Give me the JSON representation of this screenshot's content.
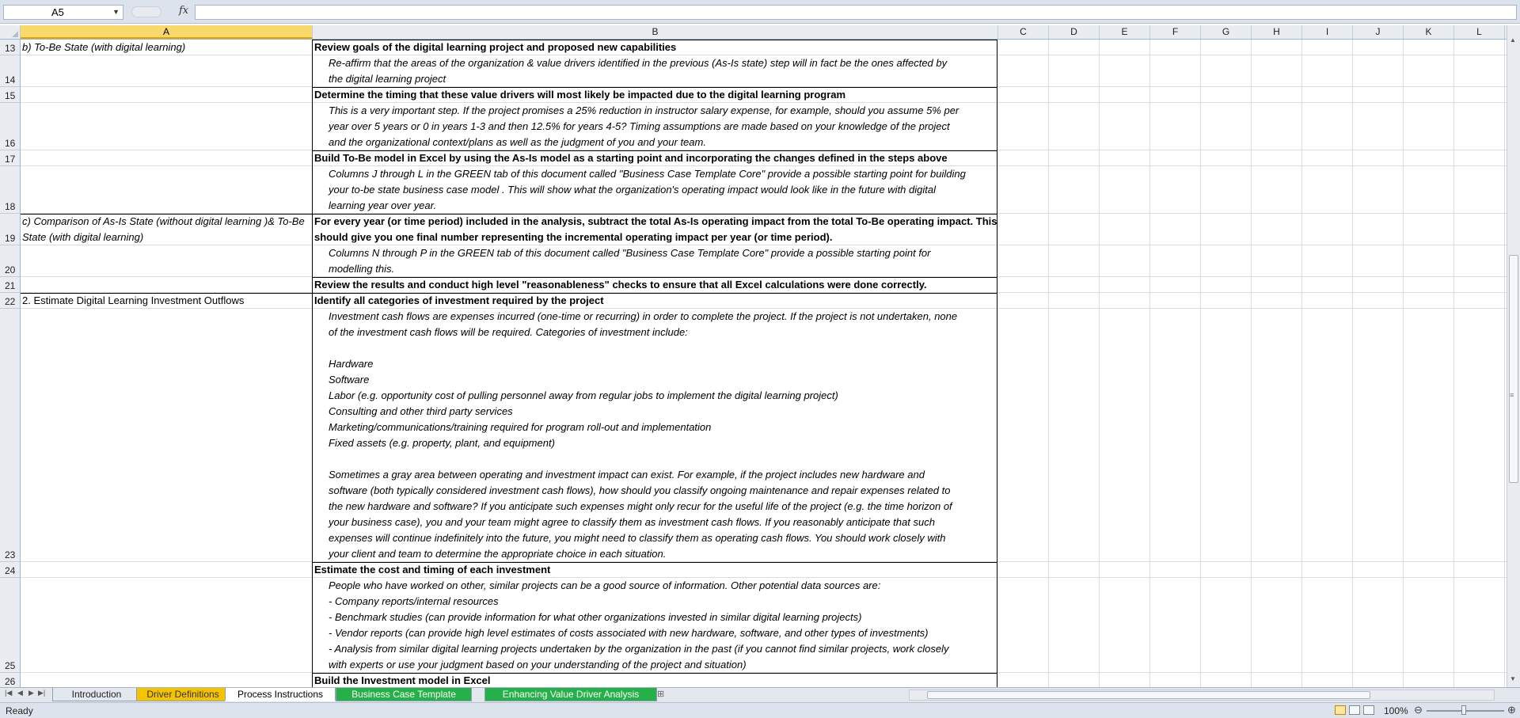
{
  "formula_bar": {
    "name_box": "A5",
    "fx_label": "fx",
    "formula": ""
  },
  "columns": [
    "A",
    "B",
    "C",
    "D",
    "E",
    "F",
    "G",
    "H",
    "I",
    "J",
    "K",
    "L"
  ],
  "active_column": "A",
  "rows": [
    {
      "num": "13",
      "a": "b) To-Be State (with digital learning)",
      "a_style": "ital",
      "b": [
        "Review goals of the digital learning project and proposed new capabilities"
      ],
      "b_style": "bold"
    },
    {
      "num": "14",
      "a": "",
      "b": [
        "Re-affirm that the areas of the organization & value drivers identified in the previous (As-Is state) step will in fact be the ones affected by",
        "the digital learning project"
      ],
      "b_style": "ital"
    },
    {
      "num": "15",
      "a": "",
      "b": [
        "Determine the timing that these value drivers will most likely be impacted due to the digital learning program"
      ],
      "b_style": "bold"
    },
    {
      "num": "16",
      "a": "",
      "b": [
        "This is a very important step. If the project promises a 25% reduction in instructor salary expense, for example, should you assume 5% per",
        "year over 5 years or 0 in years 1-3 and then 12.5% for years 4-5? Timing assumptions are made based on your knowledge of the project",
        "and the organizational context/plans as well as the judgment of you and your team."
      ],
      "b_style": "ital"
    },
    {
      "num": "17",
      "a": "",
      "b": [
        "Build To-Be model in Excel by using the As-Is model as a starting point and incorporating the changes defined in the steps above"
      ],
      "b_style": "bold"
    },
    {
      "num": "18",
      "a": "",
      "b": [
        "Columns J through L in the GREEN tab of this document called \"Business Case Template Core\" provide a possible starting point for building",
        "your to-be state business case model . This will show what the organization's operating impact would look like in the future with digital",
        "learning year over year."
      ],
      "b_style": "ital"
    },
    {
      "num": "19",
      "a": "c) Comparison of As-Is State (without digital learning )& To-Be State (with digital learning)",
      "a_style": "ital",
      "b": [
        "For every year (or time period) included in the analysis, subtract the total As-Is operating impact from the total To-Be operating impact. This",
        "should give you one final number representing the incremental operating impact per year (or time period)."
      ],
      "b_style": "bold",
      "section_top": true
    },
    {
      "num": "20",
      "a": "",
      "b": [
        "Columns N through P in the GREEN tab of this document called \"Business Case Template Core\" provide a possible starting point for",
        "modelling this."
      ],
      "b_style": "ital"
    },
    {
      "num": "21",
      "a": "",
      "b": [
        "Review the results and conduct high level \"reasonableness\" checks to ensure that all Excel calculations were done correctly."
      ],
      "b_style": "bold"
    },
    {
      "num": "22",
      "a": "2. Estimate Digital Learning Investment Outflows",
      "a_style": "normal",
      "b": [
        "Identify all categories of investment required by the project"
      ],
      "b_style": "bold",
      "section_top": true
    },
    {
      "num": "23",
      "a": "",
      "b": [
        "Investment cash flows are expenses incurred (one-time or recurring) in order to complete the project. If the project is not undertaken, none",
        "of the investment cash flows will be required. Categories of investment include:",
        "",
        "Hardware",
        "Software",
        "Labor (e.g. opportunity cost of pulling personnel away from regular jobs to implement the digital learning project)",
        "Consulting and other third party services",
        "Marketing/communications/training required for program roll-out and implementation",
        "Fixed assets (e.g. property, plant, and equipment)",
        "",
        "Sometimes a gray area between operating and investment impact can exist. For example, if the project includes new hardware and",
        "software (both typically considered investment cash flows), how should you classify ongoing maintenance and repair expenses related to",
        "the new hardware and software? If you anticipate such expenses might only recur for the useful life of the project (e.g. the time horizon of",
        "your business case), you and your team might agree to classify them as investment cash flows. If you reasonably anticipate that such",
        "expenses will continue indefinitely into the future, you might need to classify them as operating cash flows. You should work closely with",
        "your client and team to determine the appropriate choice in each situation."
      ],
      "b_style": "ital"
    },
    {
      "num": "24",
      "a": "",
      "b": [
        "Estimate the cost and timing of each investment"
      ],
      "b_style": "bold"
    },
    {
      "num": "25",
      "a": "",
      "b": [
        "People who have worked on other, similar projects can be a good source of information. Other potential data sources are:",
        "- Company reports/internal resources",
        "- Benchmark studies (can provide information for what other organizations invested in similar digital learning projects)",
        "- Vendor reports (can provide high level estimates of costs associated with new hardware, software, and other types of investments)",
        "- Analysis from similar digital learning projects undertaken by the organization in the past (if you cannot find similar projects, work closely",
        "with experts or use your judgment based on your understanding of the project and situation)"
      ],
      "b_style": "ital"
    },
    {
      "num": "26",
      "a": "",
      "b": [
        "Build the Investment model in Excel"
      ],
      "b_style": "bold"
    }
  ],
  "sheet_tabs": [
    {
      "label": "Introduction",
      "style": "plain"
    },
    {
      "label": "Driver Definitions",
      "style": "yellow"
    },
    {
      "label": "Process Instructions",
      "style": "active"
    },
    {
      "label": "Business Case Template Core",
      "style": "green"
    },
    {
      "label": "Enhancing Value Driver Analysis",
      "style": "green"
    }
  ],
  "status": {
    "ready": "Ready",
    "zoom": "100%"
  },
  "icons": {
    "nav_first": "first-sheet-icon",
    "nav_prev": "prev-sheet-icon",
    "nav_next": "next-sheet-icon",
    "nav_last": "last-sheet-icon",
    "new_sheet": "insert-sheet-icon"
  }
}
